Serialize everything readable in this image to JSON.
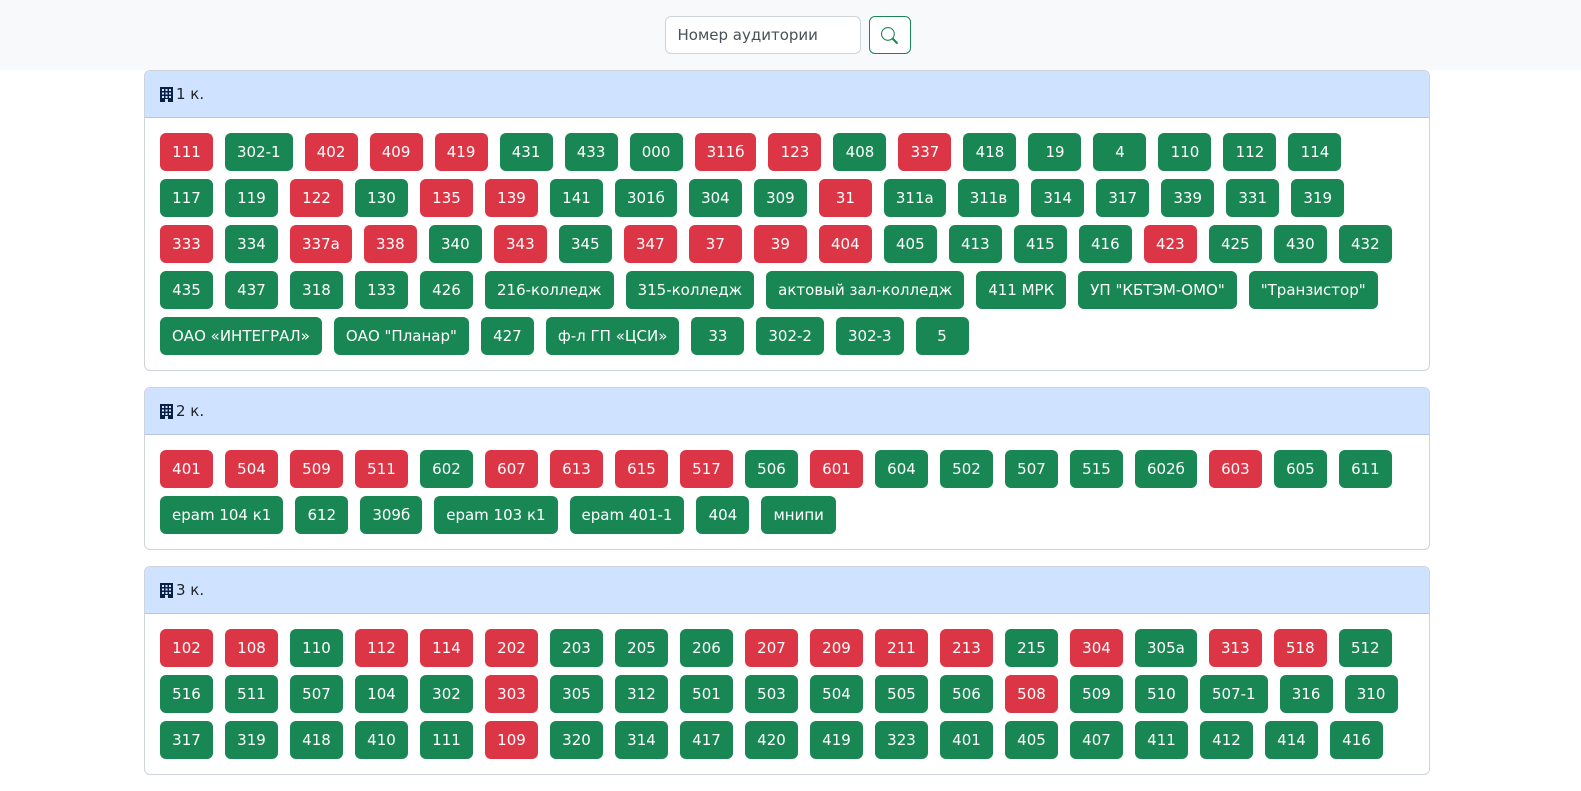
{
  "search": {
    "placeholder": "Номер аудитории",
    "icon": "search-icon",
    "accent": "#198754"
  },
  "colors": {
    "busy": "#dc3545",
    "free": "#198754",
    "header_bg": "#cfe2ff"
  },
  "buildings": [
    {
      "title": "1 к.",
      "rooms": [
        {
          "label": "111",
          "status": "busy"
        },
        {
          "label": "302-1",
          "status": "free"
        },
        {
          "label": "402",
          "status": "busy"
        },
        {
          "label": "409",
          "status": "busy"
        },
        {
          "label": "419",
          "status": "busy"
        },
        {
          "label": "431",
          "status": "free"
        },
        {
          "label": "433",
          "status": "free"
        },
        {
          "label": "000",
          "status": "free"
        },
        {
          "label": "311б",
          "status": "busy"
        },
        {
          "label": "123",
          "status": "busy"
        },
        {
          "label": "408",
          "status": "free"
        },
        {
          "label": "337",
          "status": "busy"
        },
        {
          "label": "418",
          "status": "free"
        },
        {
          "label": "19",
          "status": "free"
        },
        {
          "label": "4",
          "status": "free"
        },
        {
          "label": "110",
          "status": "free"
        },
        {
          "label": "112",
          "status": "free"
        },
        {
          "label": "114",
          "status": "free"
        },
        {
          "label": "117",
          "status": "free"
        },
        {
          "label": "119",
          "status": "free"
        },
        {
          "label": "122",
          "status": "busy"
        },
        {
          "label": "130",
          "status": "free"
        },
        {
          "label": "135",
          "status": "busy"
        },
        {
          "label": "139",
          "status": "busy"
        },
        {
          "label": "141",
          "status": "free"
        },
        {
          "label": "301б",
          "status": "free"
        },
        {
          "label": "304",
          "status": "free"
        },
        {
          "label": "309",
          "status": "free"
        },
        {
          "label": "31",
          "status": "busy"
        },
        {
          "label": "311а",
          "status": "free"
        },
        {
          "label": "311в",
          "status": "free"
        },
        {
          "label": "314",
          "status": "free"
        },
        {
          "label": "317",
          "status": "free"
        },
        {
          "label": "339",
          "status": "free"
        },
        {
          "label": "331",
          "status": "free"
        },
        {
          "label": "319",
          "status": "free"
        },
        {
          "label": "333",
          "status": "busy"
        },
        {
          "label": "334",
          "status": "free"
        },
        {
          "label": "337а",
          "status": "busy"
        },
        {
          "label": "338",
          "status": "busy"
        },
        {
          "label": "340",
          "status": "free"
        },
        {
          "label": "343",
          "status": "busy"
        },
        {
          "label": "345",
          "status": "free"
        },
        {
          "label": "347",
          "status": "busy"
        },
        {
          "label": "37",
          "status": "busy"
        },
        {
          "label": "39",
          "status": "busy"
        },
        {
          "label": "404",
          "status": "busy"
        },
        {
          "label": "405",
          "status": "free"
        },
        {
          "label": "413",
          "status": "free"
        },
        {
          "label": "415",
          "status": "free"
        },
        {
          "label": "416",
          "status": "free"
        },
        {
          "label": "423",
          "status": "busy"
        },
        {
          "label": "425",
          "status": "free"
        },
        {
          "label": "430",
          "status": "free"
        },
        {
          "label": "432",
          "status": "free"
        },
        {
          "label": "435",
          "status": "free"
        },
        {
          "label": "437",
          "status": "free"
        },
        {
          "label": "318",
          "status": "free"
        },
        {
          "label": "133",
          "status": "free"
        },
        {
          "label": "426",
          "status": "free"
        },
        {
          "label": "216-колледж",
          "status": "free"
        },
        {
          "label": "315-колледж",
          "status": "free"
        },
        {
          "label": "актовый зал-колледж",
          "status": "free"
        },
        {
          "label": "411 МРК",
          "status": "free"
        },
        {
          "label": "УП \"КБТЭМ-ОМО\"",
          "status": "free"
        },
        {
          "label": "\"Транзистор\"",
          "status": "free"
        },
        {
          "label": "ОАО «ИНТЕГРАЛ»",
          "status": "free"
        },
        {
          "label": "ОАО \"Планар\"",
          "status": "free"
        },
        {
          "label": "427",
          "status": "free"
        },
        {
          "label": "ф-л ГП «ЦСИ»",
          "status": "free"
        },
        {
          "label": "33",
          "status": "free"
        },
        {
          "label": "302-2",
          "status": "free"
        },
        {
          "label": "302-3",
          "status": "free"
        },
        {
          "label": "5",
          "status": "free"
        }
      ]
    },
    {
      "title": "2 к.",
      "rooms": [
        {
          "label": "401",
          "status": "busy"
        },
        {
          "label": "504",
          "status": "busy"
        },
        {
          "label": "509",
          "status": "busy"
        },
        {
          "label": "511",
          "status": "busy"
        },
        {
          "label": "602",
          "status": "free"
        },
        {
          "label": "607",
          "status": "busy"
        },
        {
          "label": "613",
          "status": "busy"
        },
        {
          "label": "615",
          "status": "busy"
        },
        {
          "label": "517",
          "status": "busy"
        },
        {
          "label": "506",
          "status": "free"
        },
        {
          "label": "601",
          "status": "busy"
        },
        {
          "label": "604",
          "status": "free"
        },
        {
          "label": "502",
          "status": "free"
        },
        {
          "label": "507",
          "status": "free"
        },
        {
          "label": "515",
          "status": "free"
        },
        {
          "label": "602б",
          "status": "free"
        },
        {
          "label": "603",
          "status": "busy"
        },
        {
          "label": "605",
          "status": "free"
        },
        {
          "label": "611",
          "status": "free"
        },
        {
          "label": "epam 104 к1",
          "status": "free"
        },
        {
          "label": "612",
          "status": "free"
        },
        {
          "label": "309б",
          "status": "free"
        },
        {
          "label": "epam 103 к1",
          "status": "free"
        },
        {
          "label": "epam 401-1",
          "status": "free"
        },
        {
          "label": "404",
          "status": "free"
        },
        {
          "label": "мнипи",
          "status": "free"
        }
      ]
    },
    {
      "title": "3 к.",
      "rooms": [
        {
          "label": "102",
          "status": "busy"
        },
        {
          "label": "108",
          "status": "busy"
        },
        {
          "label": "110",
          "status": "free"
        },
        {
          "label": "112",
          "status": "busy"
        },
        {
          "label": "114",
          "status": "busy"
        },
        {
          "label": "202",
          "status": "busy"
        },
        {
          "label": "203",
          "status": "free"
        },
        {
          "label": "205",
          "status": "free"
        },
        {
          "label": "206",
          "status": "free"
        },
        {
          "label": "207",
          "status": "busy"
        },
        {
          "label": "209",
          "status": "busy"
        },
        {
          "label": "211",
          "status": "busy"
        },
        {
          "label": "213",
          "status": "busy"
        },
        {
          "label": "215",
          "status": "free"
        },
        {
          "label": "304",
          "status": "busy"
        },
        {
          "label": "305а",
          "status": "free"
        },
        {
          "label": "313",
          "status": "busy"
        },
        {
          "label": "518",
          "status": "busy"
        },
        {
          "label": "512",
          "status": "free"
        },
        {
          "label": "516",
          "status": "free"
        },
        {
          "label": "511",
          "status": "free"
        },
        {
          "label": "507",
          "status": "free"
        },
        {
          "label": "104",
          "status": "free"
        },
        {
          "label": "302",
          "status": "free"
        },
        {
          "label": "303",
          "status": "busy"
        },
        {
          "label": "305",
          "status": "free"
        },
        {
          "label": "312",
          "status": "free"
        },
        {
          "label": "501",
          "status": "free"
        },
        {
          "label": "503",
          "status": "free"
        },
        {
          "label": "504",
          "status": "free"
        },
        {
          "label": "505",
          "status": "free"
        },
        {
          "label": "506",
          "status": "free"
        },
        {
          "label": "508",
          "status": "busy"
        },
        {
          "label": "509",
          "status": "free"
        },
        {
          "label": "510",
          "status": "free"
        },
        {
          "label": "507-1",
          "status": "free"
        },
        {
          "label": "316",
          "status": "free"
        },
        {
          "label": "310",
          "status": "free"
        },
        {
          "label": "317",
          "status": "free"
        },
        {
          "label": "319",
          "status": "free"
        },
        {
          "label": "418",
          "status": "free"
        },
        {
          "label": "410",
          "status": "free"
        },
        {
          "label": "111",
          "status": "free"
        },
        {
          "label": "109",
          "status": "busy"
        },
        {
          "label": "320",
          "status": "free"
        },
        {
          "label": "314",
          "status": "free"
        },
        {
          "label": "417",
          "status": "free"
        },
        {
          "label": "420",
          "status": "free"
        },
        {
          "label": "419",
          "status": "free"
        },
        {
          "label": "323",
          "status": "free"
        },
        {
          "label": "401",
          "status": "free"
        },
        {
          "label": "405",
          "status": "free"
        },
        {
          "label": "407",
          "status": "free"
        },
        {
          "label": "411",
          "status": "free"
        },
        {
          "label": "412",
          "status": "free"
        },
        {
          "label": "414",
          "status": "free"
        },
        {
          "label": "416",
          "status": "free"
        }
      ]
    }
  ]
}
